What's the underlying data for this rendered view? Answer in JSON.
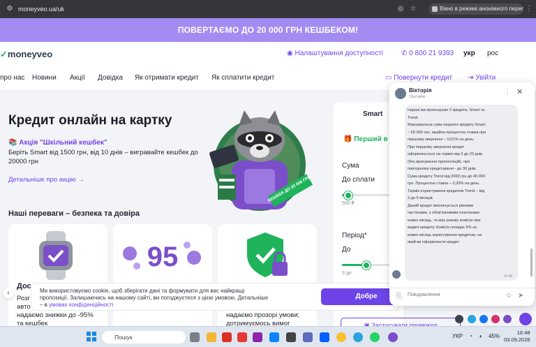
{
  "browser": {
    "url": "moneyveo.ua/uk",
    "incognito_label": "Вікно в режимі анонімного перегляду"
  },
  "promo_banner": "ПОВЕРТАЄМО ДО 20 000 ГРН КЕШБЕКОМ!",
  "header": {
    "logo_prefix": "✓",
    "logo": "moneyveo",
    "accessibility": "Налаштування доступності",
    "phone": "0 800 21 9393",
    "lang_uk": "укр",
    "lang_ru": "рос"
  },
  "nav": {
    "items": [
      "про нас",
      "Новини",
      "Акції",
      "Довідка",
      "Як отримати кредит",
      "Як сплатити кредит"
    ],
    "return_credit": "Повернути кредит",
    "login": "Увійти"
  },
  "hero": {
    "title": "Кредит онлайн на картку",
    "promo_title": "Акція \"Шкільний кешбек\"",
    "promo_desc": "Беріть Smart від 1500 грн, від 10 днів – вигравайте кешбек до 20000 грн",
    "details_link": "Детальніше про акцію",
    "badge": "КЕШБЕК ДО 20 000 ГРН"
  },
  "advantages": {
    "title": "Наші переваги – безпека та довіра",
    "card1_title": "Дос",
    "card1_text": "Розг\nавто\nнадаємо знижки до -95%\nта кешбек",
    "card2_number": "95",
    "card3_text": "надаємо прозорі умови;\nдотримуємось вимог"
  },
  "calculator": {
    "tab": "Smart",
    "first_credit": "Перший в",
    "sum_label": "Сума",
    "repay_label": "До сплати",
    "min_sum": "500 ₴",
    "period_label": "Період*",
    "period_to": "До",
    "min_days": "3 дн",
    "sum_slider_value": 0.1,
    "period_slider_value": 0.4,
    "promo_code_btn": "Застосувати промокод"
  },
  "cookie": {
    "text": "Ми використовуємо cookie, щоб зберігати дані та формувати для вас найкращі пропозиції. Залишаючись на нашому сайті, ви погоджуєтеся з цією умовою. Детальніше – в ",
    "link": "умовах конфіденційності",
    "accept": "Добре"
  },
  "chat": {
    "agent_name": "Вікторія",
    "status": "Онлайн",
    "message": [
      "Наразі ми пропонуємо 2 кредити, Smart та",
      "Trend.",
      "Максимальна сума першого кредиту Smart",
      "– 50 000 грн, акційна процентна ставка при",
      "першому зверненні – 0,01% на день.",
      "При першому зверненні кредит",
      "оформлюється на термін від 3 до 20 днів",
      "(без врахування пролонгацій), при",
      "повторному кредитуванні - до 30 днів.",
      "Сума кредиту Trend  від 2000 грн до 40 000",
      "грн. Процентна ставка – 0,33% на день.",
      "Термін користування кредитом Trend – від",
      "2 до 6 місяців.",
      "Даний кредит виплачується рівними",
      "частинами, з обов'язковими платежами",
      "кожен місяць, та має разову комісію при",
      "видачі кредиту. Комісія складає 5% за",
      "кожен місяць користування кредитом, на",
      "який ви оформлюєте кредит."
    ],
    "time": "16:48",
    "input_placeholder": "Повідомлення"
  },
  "taskbar": {
    "search": "Пошук",
    "lang": "УКР",
    "battery": "45%",
    "time": "16:48",
    "date": "03.09.2026"
  },
  "colors": {
    "promo_bg": "#a38bf2",
    "brand_purple": "#6e44e8",
    "brand_green": "#1fb35c"
  }
}
